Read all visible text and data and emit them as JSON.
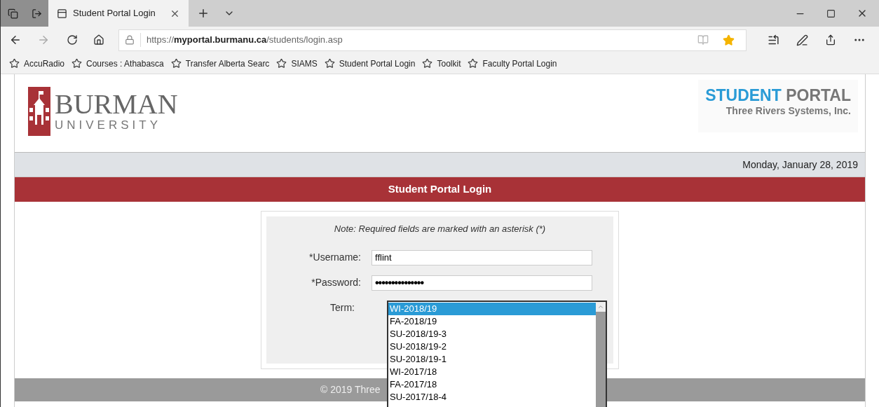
{
  "browser": {
    "tab": {
      "title": "Student Portal Login",
      "selected": true
    },
    "url": {
      "scheme": "https://",
      "host": "myportal.burmanu.ca",
      "path": "/students/login.asp"
    },
    "favorite_starred": true,
    "favorites": [
      "AccuRadio",
      "Courses : Athabasca",
      "Transfer Alberta Searc",
      "SIAMS",
      "Student Portal Login",
      "Toolkit",
      "Faculty Portal Login"
    ]
  },
  "header": {
    "university_name": "BURMAN",
    "university_word": "UNIVERSITY",
    "portal_title_first": "STUDENT",
    "portal_title_second": "PORTAL",
    "portal_company": "Three Rivers Systems, Inc."
  },
  "date": "Monday, January 28, 2019",
  "page_title": "Student Portal Login",
  "form": {
    "note": "Note: Required fields are marked with an asterisk (*)",
    "username": {
      "label": "*Username:",
      "value": "fflint"
    },
    "password": {
      "label": "*Password:",
      "value": "•••••••••••••••"
    },
    "term": {
      "label": "Term:",
      "expanded": true,
      "options": [
        {
          "label": "WI-2018/19",
          "selected": true
        },
        {
          "label": "FA-2018/19",
          "selected": false
        },
        {
          "label": "SU-2018/19-3",
          "selected": false
        },
        {
          "label": "SU-2018/19-2",
          "selected": false
        },
        {
          "label": "SU-2018/19-1",
          "selected": false
        },
        {
          "label": "WI-2017/18",
          "selected": false
        },
        {
          "label": "FA-2017/18",
          "selected": false
        },
        {
          "label": "SU-2017/18-4",
          "selected": false
        }
      ]
    }
  },
  "footer": "© 2019 Three"
}
